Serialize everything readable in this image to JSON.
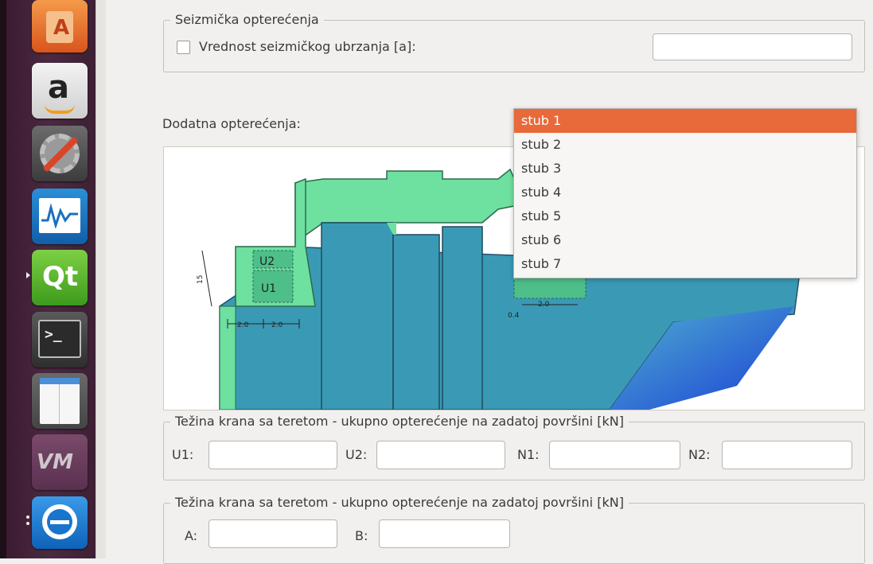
{
  "launcher": {
    "apps": [
      "software-center-icon",
      "amazon-icon",
      "system-settings-icon",
      "system-monitor-icon",
      "qt-creator-icon",
      "terminal-icon",
      "file-editor-icon",
      "vmware-icon",
      "teamviewer-icon"
    ],
    "amazon_letter": "a",
    "qt_letter": "Qt",
    "terminal_prompt": ">_",
    "vm_text": "VM"
  },
  "seismic": {
    "group_title": "Seizmička opterećenja",
    "checkbox_label": "Vrednost seizmičkog ubrzanja [a]:",
    "checkbox_checked": false,
    "value": ""
  },
  "additional": {
    "label": "Dodatna opterećenja:",
    "selected": "stub 1",
    "options": [
      "stub 1",
      "stub 2",
      "stub 3",
      "stub 4",
      "stub 5",
      "stub 6",
      "stub 7"
    ]
  },
  "drawing": {
    "labels": [
      "U2",
      "U1",
      "2.0",
      "2.0",
      "2.0",
      "0.4",
      "15"
    ]
  },
  "crane1": {
    "group_title": "Težina krana sa teretom - ukupno opterećenje na zadatoj površini [kN]",
    "fields": [
      {
        "label": "U1:",
        "value": ""
      },
      {
        "label": "U2:",
        "value": ""
      },
      {
        "label": "N1:",
        "value": ""
      },
      {
        "label": "N2:",
        "value": ""
      }
    ]
  },
  "crane2": {
    "group_title": "Težina krana sa teretom - ukupno opterećenje na zadatoj površini [kN]",
    "fields": [
      {
        "label": "A:",
        "value": ""
      },
      {
        "label": "B:",
        "value": ""
      }
    ]
  },
  "colors": {
    "accent": "#e8693a",
    "launcher_bg": "#4a2a40",
    "green_mesh": "#6ee0a0",
    "teal_mesh": "#3a9ab5"
  }
}
